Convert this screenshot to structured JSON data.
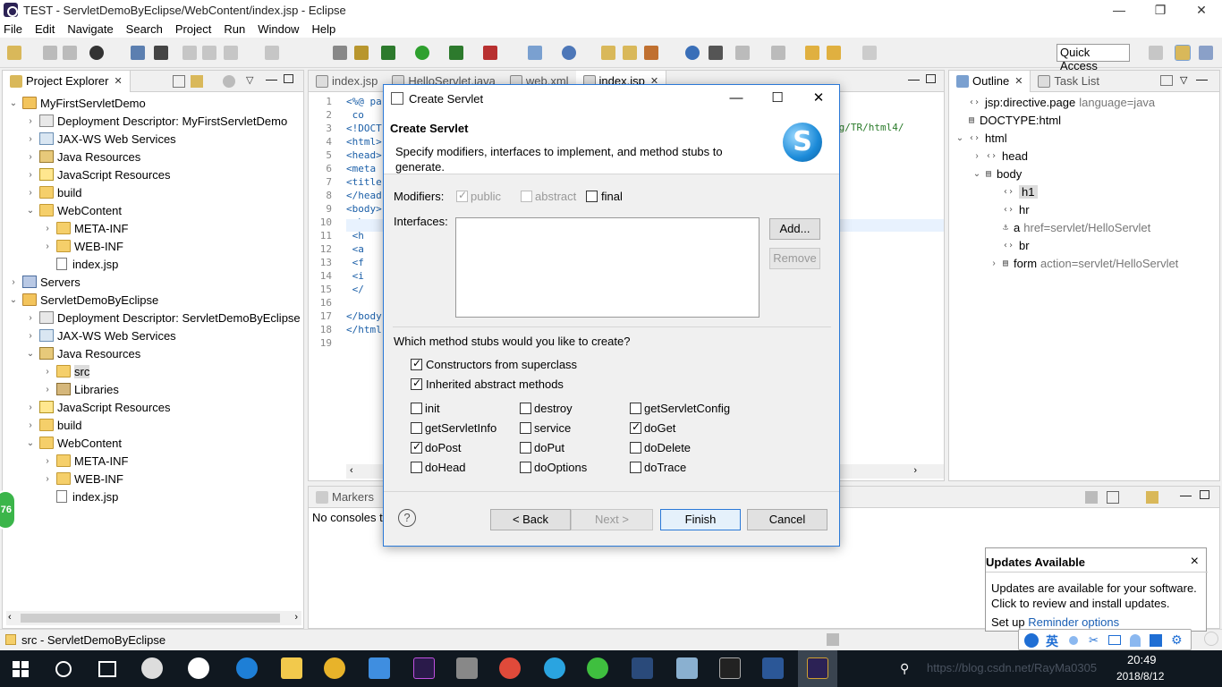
{
  "window": {
    "title": "TEST - ServletDemoByEclipse/WebContent/index.jsp - Eclipse",
    "minimize": "—",
    "maximize": "❐",
    "close": "✕"
  },
  "menu": [
    "File",
    "Edit",
    "Navigate",
    "Search",
    "Project",
    "Run",
    "Window",
    "Help"
  ],
  "quick_access": "Quick Access",
  "project_explorer": {
    "tab": "Project Explorer",
    "tree": [
      {
        "label": "MyFirstServletDemo",
        "depth": 0,
        "arrow": "v",
        "icon": "project"
      },
      {
        "label": "Deployment Descriptor: MyFirstServletDemo",
        "depth": 1,
        "arrow": ">",
        "icon": "dd"
      },
      {
        "label": "JAX-WS Web Services",
        "depth": 1,
        "arrow": ">",
        "icon": "ws"
      },
      {
        "label": "Java Resources",
        "depth": 1,
        "arrow": ">",
        "icon": "java"
      },
      {
        "label": "JavaScript Resources",
        "depth": 1,
        "arrow": ">",
        "icon": "js"
      },
      {
        "label": "build",
        "depth": 1,
        "arrow": ">",
        "icon": "folder"
      },
      {
        "label": "WebContent",
        "depth": 1,
        "arrow": "v",
        "icon": "folder"
      },
      {
        "label": "META-INF",
        "depth": 2,
        "arrow": ">",
        "icon": "folder"
      },
      {
        "label": "WEB-INF",
        "depth": 2,
        "arrow": ">",
        "icon": "folder"
      },
      {
        "label": "index.jsp",
        "depth": 2,
        "arrow": "",
        "icon": "file"
      },
      {
        "label": "Servers",
        "depth": 0,
        "arrow": ">",
        "icon": "servers"
      },
      {
        "label": "ServletDemoByEclipse",
        "depth": 0,
        "arrow": "v",
        "icon": "project"
      },
      {
        "label": "Deployment Descriptor: ServletDemoByEclipse",
        "depth": 1,
        "arrow": ">",
        "icon": "dd"
      },
      {
        "label": "JAX-WS Web Services",
        "depth": 1,
        "arrow": ">",
        "icon": "ws"
      },
      {
        "label": "Java Resources",
        "depth": 1,
        "arrow": "v",
        "icon": "java"
      },
      {
        "label": "src",
        "depth": 2,
        "arrow": ">",
        "icon": "folder",
        "selected": true
      },
      {
        "label": "Libraries",
        "depth": 2,
        "arrow": ">",
        "icon": "lib"
      },
      {
        "label": "JavaScript Resources",
        "depth": 1,
        "arrow": ">",
        "icon": "js"
      },
      {
        "label": "build",
        "depth": 1,
        "arrow": ">",
        "icon": "folder"
      },
      {
        "label": "WebContent",
        "depth": 1,
        "arrow": "v",
        "icon": "folder"
      },
      {
        "label": "META-INF",
        "depth": 2,
        "arrow": ">",
        "icon": "folder"
      },
      {
        "label": "WEB-INF",
        "depth": 2,
        "arrow": ">",
        "icon": "folder"
      },
      {
        "label": "index.jsp",
        "depth": 2,
        "arrow": "",
        "icon": "file"
      }
    ]
  },
  "editor": {
    "tabs": [
      {
        "label": "index.jsp",
        "active": false
      },
      {
        "label": "HelloServlet.java",
        "active": false
      },
      {
        "label": "web.xml",
        "active": false
      },
      {
        "label": "index.jsp",
        "active": true
      }
    ],
    "lines": [
      {
        "n": "1",
        "text": "<%@ pa"
      },
      {
        "n": "2",
        "text": "    co"
      },
      {
        "n": "3",
        "text": "<!DOCT"
      },
      {
        "n": "4",
        "text": "<html>"
      },
      {
        "n": "5",
        "text": "<head>"
      },
      {
        "n": "6",
        "text": "<meta "
      },
      {
        "n": "7",
        "text": "<title"
      },
      {
        "n": "8",
        "text": "</head"
      },
      {
        "n": "9",
        "text": "<body>"
      },
      {
        "n": "10",
        "text": "    <h"
      },
      {
        "n": "11",
        "text": "    <h"
      },
      {
        "n": "12",
        "text": "    <a"
      },
      {
        "n": "13",
        "text": "    <f"
      },
      {
        "n": "14",
        "text": "    <i"
      },
      {
        "n": "15",
        "text": "    </"
      },
      {
        "n": "16",
        "text": ""
      },
      {
        "n": "17",
        "text": "</body"
      },
      {
        "n": "18",
        "text": "</html"
      },
      {
        "n": "19",
        "text": ""
      }
    ],
    "right_fragment": "rg/TR/html4/"
  },
  "outline": {
    "tabs": [
      "Outline",
      "Task List"
    ],
    "rows": [
      {
        "label": "jsp:directive.page",
        "sub": "language=java",
        "depth": 0,
        "arrow": "",
        "icon": "<>"
      },
      {
        "label": "DOCTYPE:html",
        "sub": "",
        "depth": 0,
        "arrow": "",
        "icon": "doc"
      },
      {
        "label": "html",
        "sub": "",
        "depth": 0,
        "arrow": "v",
        "icon": "<>"
      },
      {
        "label": "head",
        "sub": "",
        "depth": 1,
        "arrow": ">",
        "icon": "<>"
      },
      {
        "label": "body",
        "sub": "",
        "depth": 1,
        "arrow": "v",
        "icon": "doc"
      },
      {
        "label": "h1",
        "sub": "",
        "depth": 2,
        "arrow": "",
        "icon": "<>",
        "selected": true
      },
      {
        "label": "hr",
        "sub": "",
        "depth": 2,
        "arrow": "",
        "icon": "<>"
      },
      {
        "label": "a",
        "sub": "href=servlet/HelloServlet",
        "depth": 2,
        "arrow": "",
        "icon": "anchor"
      },
      {
        "label": "br",
        "sub": "",
        "depth": 2,
        "arrow": "",
        "icon": "<>"
      },
      {
        "label": "form",
        "sub": "action=servlet/HelloServlet",
        "depth": 2,
        "arrow": ">",
        "icon": "doc"
      }
    ]
  },
  "console": {
    "tab": "Markers",
    "text": "No consoles t"
  },
  "dialog": {
    "window_title": "Create Servlet",
    "title": "Create Servlet",
    "description": "Specify modifiers, interfaces to implement, and method stubs to generate.",
    "modifiers_label": "Modifiers:",
    "modifiers": [
      {
        "label": "public",
        "checked": true,
        "disabled": true
      },
      {
        "label": "abstract",
        "checked": false,
        "disabled": true
      },
      {
        "label": "final",
        "checked": false,
        "disabled": false
      }
    ],
    "interfaces_label": "Interfaces:",
    "add_button": "Add...",
    "remove_button": "Remove",
    "stubs_question": "Which method stubs would you like to create?",
    "stubs_main": [
      {
        "label": "Constructors from superclass",
        "checked": true
      },
      {
        "label": "Inherited abstract methods",
        "checked": true
      }
    ],
    "stubs_grid": [
      {
        "label": "init",
        "checked": false
      },
      {
        "label": "destroy",
        "checked": false
      },
      {
        "label": "getServletConfig",
        "checked": false
      },
      {
        "label": "getServletInfo",
        "checked": false
      },
      {
        "label": "service",
        "checked": false
      },
      {
        "label": "doGet",
        "checked": true
      },
      {
        "label": "doPost",
        "checked": true
      },
      {
        "label": "doPut",
        "checked": false
      },
      {
        "label": "doDelete",
        "checked": false
      },
      {
        "label": "doHead",
        "checked": false
      },
      {
        "label": "doOptions",
        "checked": false
      },
      {
        "label": "doTrace",
        "checked": false
      }
    ],
    "help": "?",
    "back_button": "< Back",
    "next_button": "Next >",
    "finish_button": "Finish",
    "cancel_button": "Cancel"
  },
  "updates": {
    "title": "Updates Available",
    "close": "×",
    "message": "Updates are available for your software. Click to review and install updates.",
    "setup_prefix": "Set up ",
    "setup_link": "Reminder options"
  },
  "statusbar": {
    "text": "src - ServletDemoByEclipse"
  },
  "badge": "76",
  "taskbar": {
    "time": "20:49",
    "date": "2018/8/12",
    "ime": "英",
    "watermark": "https://blog.csdn.net/RayMa0305"
  }
}
